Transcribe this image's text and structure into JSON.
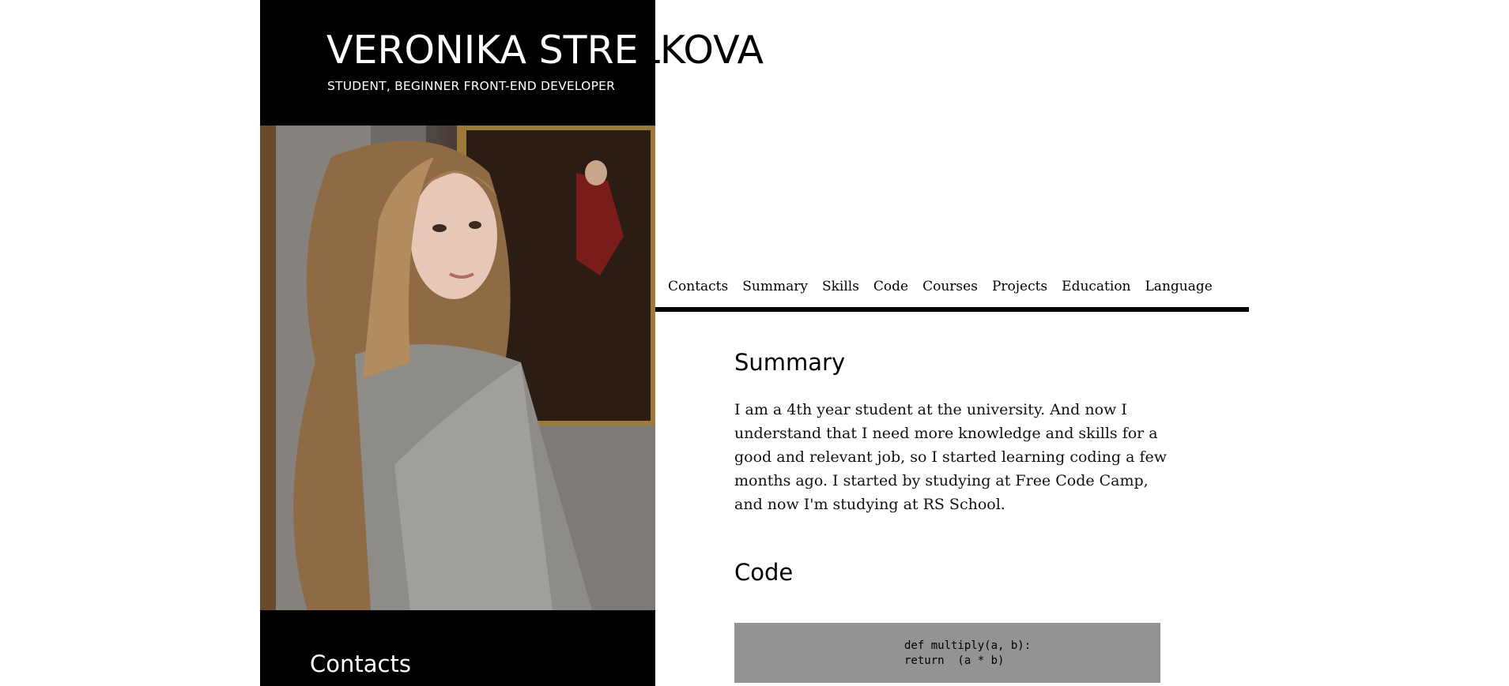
{
  "header": {
    "name_part1": "VERONIKA STRE",
    "name_part2": "LKOVA",
    "subtitle": "STUDENT, BEGINNER FRONT-END DEVELOPER"
  },
  "sidebar": {
    "contacts_heading": "Contacts"
  },
  "nav": {
    "items": [
      "Contacts",
      "Summary",
      "Skills",
      "Code",
      "Courses",
      "Projects",
      "Education",
      "Language"
    ]
  },
  "summary": {
    "title": "Summary",
    "text": "I am a 4th year student at the university. And now I understand that I need more knowledge and skills for a good and relevant job, so I started learning coding a few months ago. I started by studying at Free Code Camp, and now I'm studying at RS School."
  },
  "code": {
    "title": "Code",
    "line1": "def multiply(a, b):",
    "line2": "return  (a * b)"
  },
  "colors": {
    "sidebar_bg": "#000000",
    "code_bg": "#939393",
    "nav_border": "#000000"
  }
}
